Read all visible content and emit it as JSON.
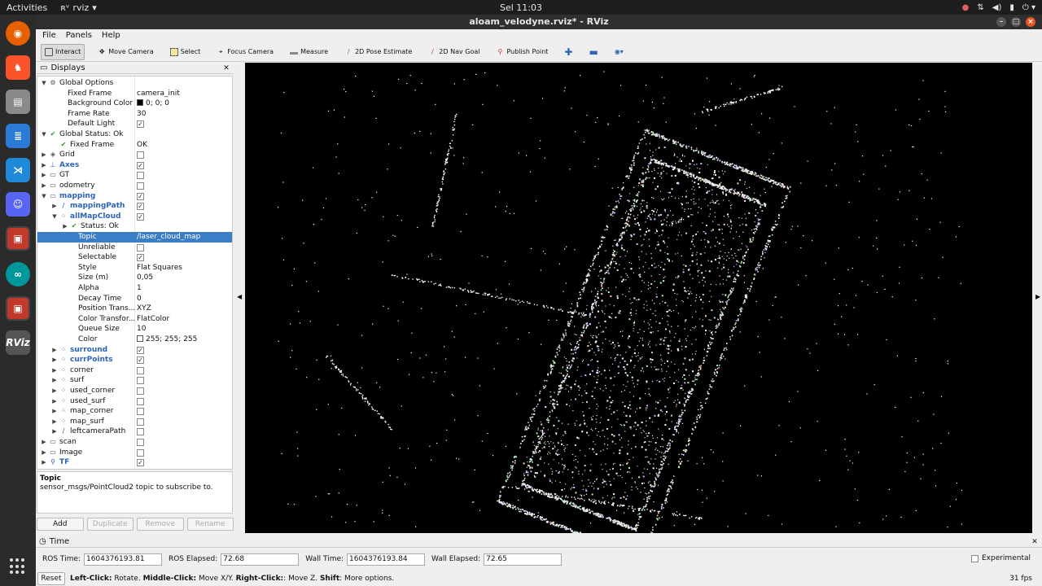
{
  "topbar": {
    "activities": "Activities",
    "app_name": "rviz",
    "clock": "Sel 11:03"
  },
  "window": {
    "title": "aloam_velodyne.rviz* - RViz"
  },
  "menu": [
    {
      "label": "File"
    },
    {
      "label": "Panels"
    },
    {
      "label": "Help"
    }
  ],
  "toolbar": [
    {
      "label": "Interact",
      "icon": "interact-icon",
      "active": true
    },
    {
      "label": "Move Camera",
      "icon": "move-camera-icon"
    },
    {
      "label": "Select",
      "icon": "select-icon"
    },
    {
      "label": "Focus Camera",
      "icon": "focus-camera-icon"
    },
    {
      "label": "Measure",
      "icon": "measure-icon"
    },
    {
      "label": "2D Pose Estimate",
      "icon": "pose-estimate-icon"
    },
    {
      "label": "2D Nav Goal",
      "icon": "nav-goal-icon"
    },
    {
      "label": "Publish Point",
      "icon": "publish-point-icon"
    }
  ],
  "displays": {
    "title": "Displays",
    "rows": [
      {
        "indent": 0,
        "arrow": "▼",
        "icon": "⚙",
        "label": "Global Options",
        "value": ""
      },
      {
        "indent": 1,
        "arrow": "",
        "icon": "",
        "label": "Fixed Frame",
        "value": "camera_init"
      },
      {
        "indent": 1,
        "arrow": "",
        "icon": "",
        "label": "Background Color",
        "value": "0; 0; 0",
        "swatch": "#000000"
      },
      {
        "indent": 1,
        "arrow": "",
        "icon": "",
        "label": "Frame Rate",
        "value": "30"
      },
      {
        "indent": 1,
        "arrow": "",
        "icon": "",
        "label": "Default Light",
        "check": true
      },
      {
        "indent": 0,
        "arrow": "▼",
        "icon": "✔",
        "label": "Global Status: Ok",
        "value": ""
      },
      {
        "indent": 1,
        "arrow": "",
        "icon": "✔",
        "label": "Fixed Frame",
        "value": "OK"
      },
      {
        "indent": 0,
        "arrow": "▶",
        "icon": "◈",
        "label": "Grid",
        "check": false
      },
      {
        "indent": 0,
        "arrow": "▶",
        "icon": "⊥",
        "label": "Axes",
        "check": true,
        "blue": true
      },
      {
        "indent": 0,
        "arrow": "▶",
        "icon": "▭",
        "label": "GT",
        "check": false
      },
      {
        "indent": 0,
        "arrow": "▶",
        "icon": "▭",
        "label": "odometry",
        "check": false
      },
      {
        "indent": 0,
        "arrow": "▼",
        "icon": "▭",
        "label": "mapping",
        "check": true,
        "blue": true
      },
      {
        "indent": 1,
        "arrow": "▶",
        "icon": "∕",
        "label": "mappingPath",
        "check": true,
        "blue": true
      },
      {
        "indent": 1,
        "arrow": "▼",
        "icon": "⁘",
        "label": "allMapCloud",
        "check": true,
        "blue": true
      },
      {
        "indent": 2,
        "arrow": "▶",
        "icon": "✔",
        "label": "Status: Ok",
        "value": ""
      },
      {
        "indent": 2,
        "arrow": "",
        "icon": "",
        "label": "Topic",
        "value": "/laser_cloud_map",
        "selected": true
      },
      {
        "indent": 2,
        "arrow": "",
        "icon": "",
        "label": "Unreliable",
        "check": false
      },
      {
        "indent": 2,
        "arrow": "",
        "icon": "",
        "label": "Selectable",
        "check": true
      },
      {
        "indent": 2,
        "arrow": "",
        "icon": "",
        "label": "Style",
        "value": "Flat Squares"
      },
      {
        "indent": 2,
        "arrow": "",
        "icon": "",
        "label": "Size (m)",
        "value": "0,05"
      },
      {
        "indent": 2,
        "arrow": "",
        "icon": "",
        "label": "Alpha",
        "value": "1"
      },
      {
        "indent": 2,
        "arrow": "",
        "icon": "",
        "label": "Decay Time",
        "value": "0"
      },
      {
        "indent": 2,
        "arrow": "",
        "icon": "",
        "label": "Position Trans...",
        "value": "XYZ"
      },
      {
        "indent": 2,
        "arrow": "",
        "icon": "",
        "label": "Color Transfor...",
        "value": "FlatColor"
      },
      {
        "indent": 2,
        "arrow": "",
        "icon": "",
        "label": "Queue Size",
        "value": "10"
      },
      {
        "indent": 2,
        "arrow": "",
        "icon": "",
        "label": "Color",
        "value": "255; 255; 255",
        "swatch": "#ffffff"
      },
      {
        "indent": 1,
        "arrow": "▶",
        "icon": "⁘",
        "label": "surround",
        "check": true,
        "blue": true
      },
      {
        "indent": 1,
        "arrow": "▶",
        "icon": "⁘",
        "label": "currPoints",
        "check": true,
        "blue": true
      },
      {
        "indent": 1,
        "arrow": "▶",
        "icon": "⁘",
        "label": "corner",
        "check": false
      },
      {
        "indent": 1,
        "arrow": "▶",
        "icon": "⁘",
        "label": "surf",
        "check": false
      },
      {
        "indent": 1,
        "arrow": "▶",
        "icon": "⁘",
        "label": "used_corner",
        "check": false
      },
      {
        "indent": 1,
        "arrow": "▶",
        "icon": "⁘",
        "label": "used_surf",
        "check": false
      },
      {
        "indent": 1,
        "arrow": "▶",
        "icon": "⁘",
        "label": "map_corner",
        "check": false
      },
      {
        "indent": 1,
        "arrow": "▶",
        "icon": "⁘",
        "label": "map_surf",
        "check": false
      },
      {
        "indent": 1,
        "arrow": "▶",
        "icon": "∕",
        "label": "leftcameraPath",
        "check": false
      },
      {
        "indent": 0,
        "arrow": "▶",
        "icon": "▭",
        "label": "scan",
        "check": false
      },
      {
        "indent": 0,
        "arrow": "▶",
        "icon": "▭",
        "label": "Image",
        "check": false
      },
      {
        "indent": 0,
        "arrow": "▶",
        "icon": "⚲",
        "label": "TF",
        "check": true,
        "blue": true
      }
    ],
    "desc_title": "Topic",
    "desc_text": "sensor_msgs/PointCloud2 topic to subscribe to.",
    "buttons": [
      {
        "label": "Add",
        "disabled": false
      },
      {
        "label": "Duplicate",
        "disabled": true
      },
      {
        "label": "Remove",
        "disabled": true
      },
      {
        "label": "Rename",
        "disabled": true
      }
    ]
  },
  "time": {
    "title": "Time",
    "ros_time_label": "ROS Time:",
    "ros_time": "1604376193.81",
    "ros_elapsed_label": "ROS Elapsed:",
    "ros_elapsed": "72.68",
    "wall_time_label": "Wall Time:",
    "wall_time": "1604376193.84",
    "wall_elapsed_label": "Wall Elapsed:",
    "wall_elapsed": "72.65",
    "experimental": "Experimental"
  },
  "status": {
    "reset": "Reset",
    "h1b": "Left-Click:",
    "h1": " Rotate. ",
    "h2b": "Middle-Click:",
    "h2": " Move X/Y. ",
    "h3b": "Right-Click:",
    "h3": ": Move Z. ",
    "h4b": "Shift",
    "h4": ": More options.",
    "fps": "31 fps"
  }
}
